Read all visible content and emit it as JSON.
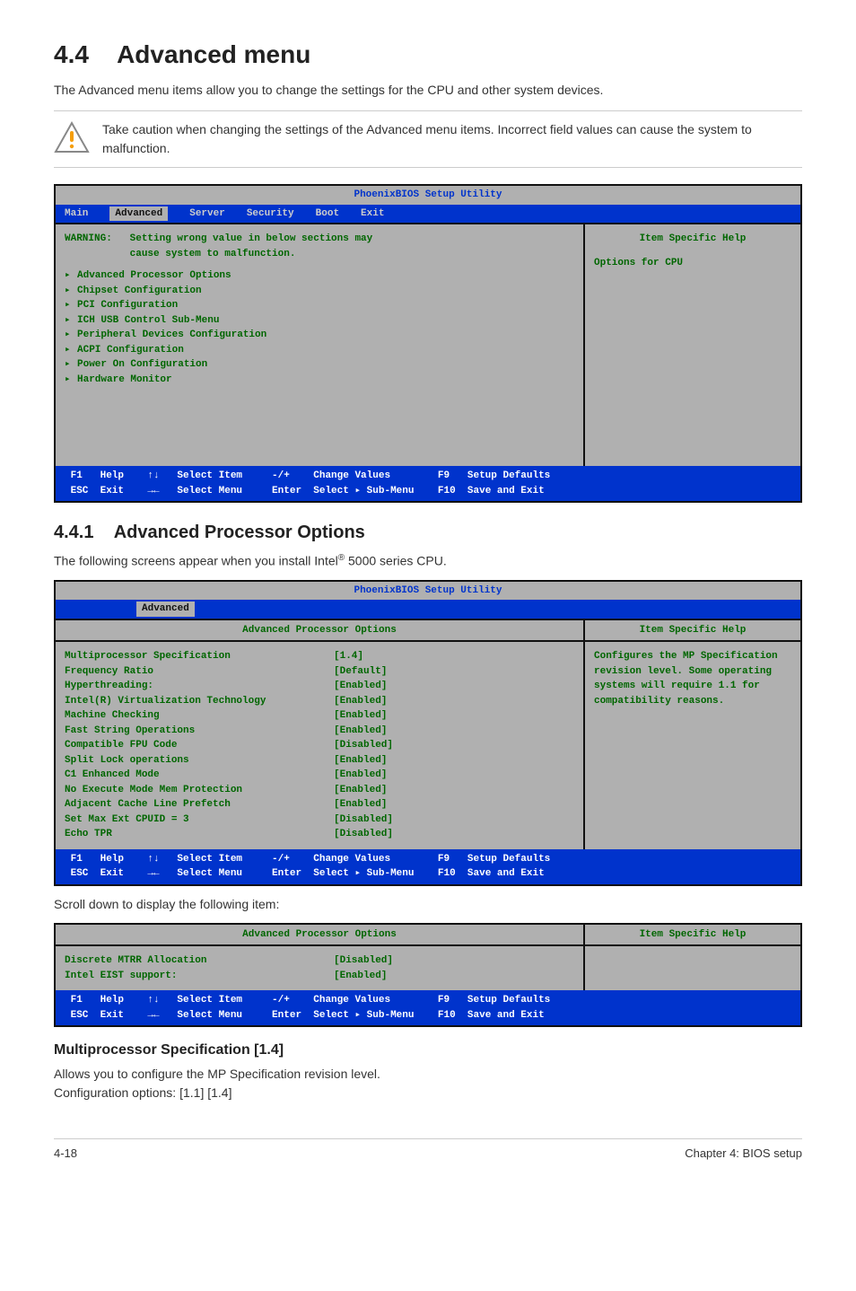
{
  "heading": {
    "number": "4.4",
    "title": "Advanced menu"
  },
  "intro": "The Advanced menu items allow you to change the settings for the CPU and other system devices.",
  "caution": "Take caution when changing the settings of the Advanced menu items. Incorrect field values can cause the system to malfunction.",
  "bios_title": "PhoenixBIOS Setup Utility",
  "menubar": [
    "Main",
    "Advanced",
    "Server",
    "Security",
    "Boot",
    "Exit"
  ],
  "bios1": {
    "warning_l1": "WARNING:   Setting wrong value in below sections may",
    "warning_l2": "           cause system to malfunction.",
    "items": [
      "Advanced Processor Options",
      "Chipset Configuration",
      "PCI Configuration",
      "ICH USB Control Sub-Menu",
      "Peripheral Devices Configuration",
      "ACPI Configuration",
      "Power On Configuration",
      "Hardware Monitor"
    ],
    "help_title": "Item Specific Help",
    "help_body": "Options for CPU"
  },
  "footer": {
    "l1_a": " F1   Help    ↑↓   Select Item     -/+    Change Values        F9   Setup Defaults",
    "l2_a": " ESC  Exit    →←   Select Menu     Enter  Select ▸ Sub-Menu    F10  Save and Exit"
  },
  "section": {
    "number": "4.4.1",
    "title": "Advanced Processor Options"
  },
  "section_intro_a": "The following screens appear when you install Intel",
  "section_intro_b": " 5000 series CPU.",
  "bios2": {
    "panel_title": "Advanced Processor Options",
    "help_title": "Item Specific Help",
    "help_body": "Configures the MP Specification revision level. Some operating systems will require 1.1 for compatibility reasons.",
    "rows": [
      {
        "k": "Multiprocessor Specification",
        "v": "[1.4]"
      },
      {
        "k": "Frequency Ratio",
        "v": "[Default]"
      },
      {
        "k": "Hyperthreading:",
        "v": "[Enabled]"
      },
      {
        "k": "",
        "v": ""
      },
      {
        "k": "Intel(R) Virtualization Technology",
        "v": "[Enabled]"
      },
      {
        "k": "Machine Checking",
        "v": "[Enabled]"
      },
      {
        "k": "",
        "v": ""
      },
      {
        "k": "Fast String Operations",
        "v": "[Enabled]"
      },
      {
        "k": "Compatible FPU Code",
        "v": "[Disabled]"
      },
      {
        "k": "Split Lock operations",
        "v": "[Enabled]"
      },
      {
        "k": "C1 Enhanced Mode",
        "v": "[Enabled]"
      },
      {
        "k": "No Execute Mode Mem Protection",
        "v": "[Enabled]"
      },
      {
        "k": "Adjacent Cache Line Prefetch",
        "v": "[Enabled]"
      },
      {
        "k": "Set Max Ext CPUID = 3",
        "v": "[Disabled]"
      },
      {
        "k": "Echo TPR",
        "v": "[Disabled]"
      }
    ]
  },
  "scroll_note": "Scroll down to display the following item:",
  "bios3": {
    "panel_title": "Advanced Processor Options",
    "help_title": "Item Specific Help",
    "rows": [
      {
        "k": "Discrete MTRR Allocation",
        "v": "[Disabled]"
      },
      {
        "k": "Intel EIST support:",
        "v": "[Enabled]"
      }
    ]
  },
  "subhead": "Multiprocessor Specification [1.4]",
  "subbody1": "Allows you to configure the MP Specification revision level.",
  "subbody2": "Configuration options: [1.1] [1.4]",
  "page_footer_left": "4-18",
  "page_footer_right": "Chapter 4: BIOS setup"
}
